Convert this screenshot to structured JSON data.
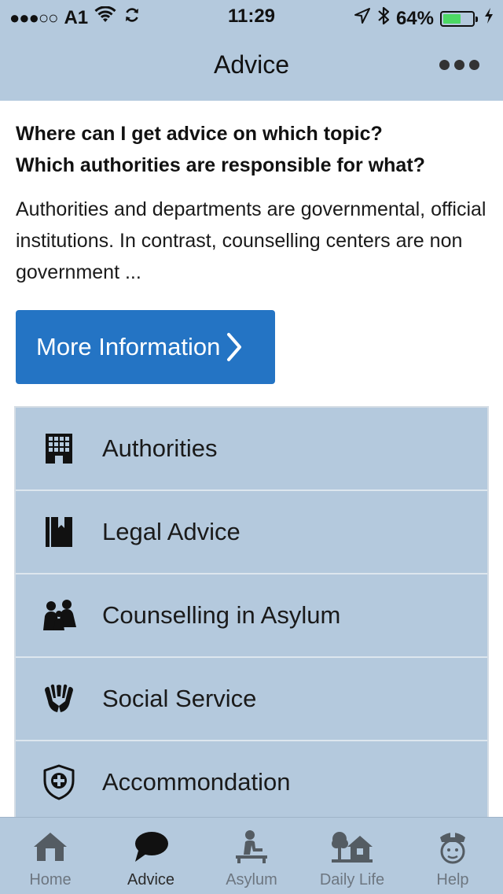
{
  "status_bar": {
    "carrier": "A1",
    "signal_dots": "●●●○○",
    "time": "11:29",
    "battery_percent": "64%",
    "battery_level": 0.64
  },
  "nav": {
    "title": "Advice",
    "more_icon": "more-dots-icon"
  },
  "main": {
    "heading_line1": "Where can I get advice on which topic?",
    "heading_line2": "Which authorities are responsible for what?",
    "intro": "Authorities and departments are governmental, official institutions. In contrast, counselling centers are non government ...",
    "more_button_label": "More Information"
  },
  "list": {
    "items": [
      {
        "label": "Authorities",
        "icon": "building-icon"
      },
      {
        "label": "Legal Advice",
        "icon": "book-icon"
      },
      {
        "label": "Counselling in Asylum",
        "icon": "people-icon"
      },
      {
        "label": "Social Service",
        "icon": "hands-icon"
      },
      {
        "label": "Accommondation",
        "icon": "shield-plus-icon"
      }
    ]
  },
  "tabbar": {
    "tabs": [
      {
        "label": "Home",
        "icon": "home-icon",
        "active": false
      },
      {
        "label": "Advice",
        "icon": "speech-bubble-icon",
        "active": true
      },
      {
        "label": "Asylum",
        "icon": "asylum-desk-icon",
        "active": false
      },
      {
        "label": "Daily Life",
        "icon": "tree-house-icon",
        "active": false
      },
      {
        "label": "Help",
        "icon": "police-officer-icon",
        "active": false
      }
    ]
  },
  "colors": {
    "bar_background": "#b4c9dd",
    "button_blue": "#2474c4",
    "battery_green": "#4cd964"
  }
}
